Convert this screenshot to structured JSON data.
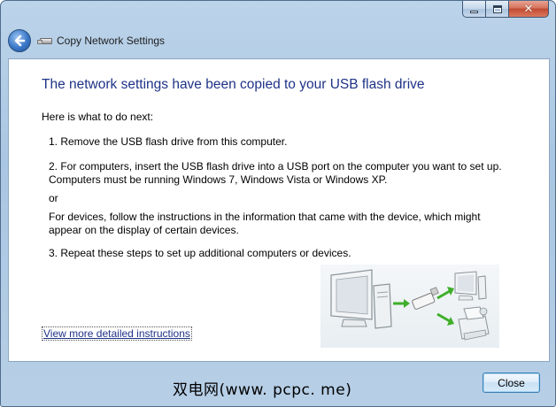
{
  "window": {
    "title": "Copy Network Settings",
    "controls": {
      "minimize": "minimize-icon",
      "maximize": "maximize-icon",
      "close": "close-icon",
      "close_glyph": "✕"
    }
  },
  "main": {
    "heading": "The network settings have been copied to your USB flash drive",
    "intro": "Here is what to do next:",
    "step1": "1. Remove the USB flash drive from this computer.",
    "step2": "2. For computers, insert the USB flash drive into a USB port on the computer you want to set up. Computers must be running Windows 7, Windows Vista or Windows XP.",
    "or": "or",
    "devices": "For devices, follow the instructions in the information that came with the device, which might appear on the display of certain devices.",
    "step3": "3. Repeat these steps to set up additional computers or devices.",
    "link": "View more detailed instructions"
  },
  "footer": {
    "watermark": "双电网(www. pcpc. me)",
    "close_label": "Close"
  },
  "colors": {
    "heading": "#1e3287",
    "link": "#1e3287",
    "arrow_green": "#3fae2a",
    "frame": "#a9c6e2"
  }
}
